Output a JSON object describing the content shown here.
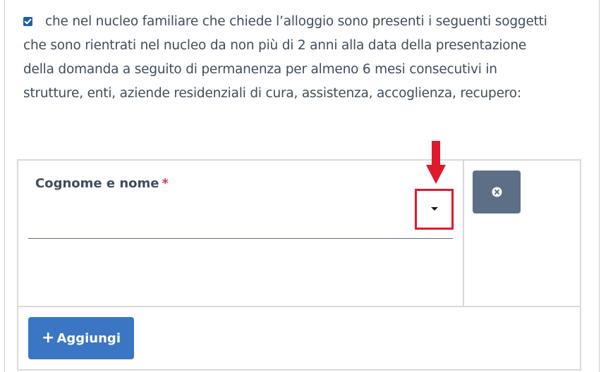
{
  "declaration": {
    "checked": true,
    "text": "che nel nucleo familiare che chiede l’alloggio sono presenti i seguenti soggetti che sono rientrati nel nucleo da non più di 2 anni alla data della presentazione della domanda a seguito di permanenza per almeno 6 mesi consecutivi in strutture, enti, aziende residenziali di cura, assistenza, accoglienza, recupero:"
  },
  "form": {
    "field_label": "Cognome e nome",
    "required_marker": "*",
    "select_value": "",
    "add_button_label": "Aggiungi"
  },
  "icons": {
    "checkbox": "checkbox-checked-icon",
    "dropdown": "caret-down-icon",
    "remove": "times-circle-icon",
    "add": "plus-icon",
    "annotation": "red-arrow-down-icon"
  },
  "colors": {
    "checkbox": "#1c5fb0",
    "remove_button": "#5c6f84",
    "add_button": "#3a76c4",
    "highlight": "#e0192b",
    "required": "#d9364f"
  }
}
